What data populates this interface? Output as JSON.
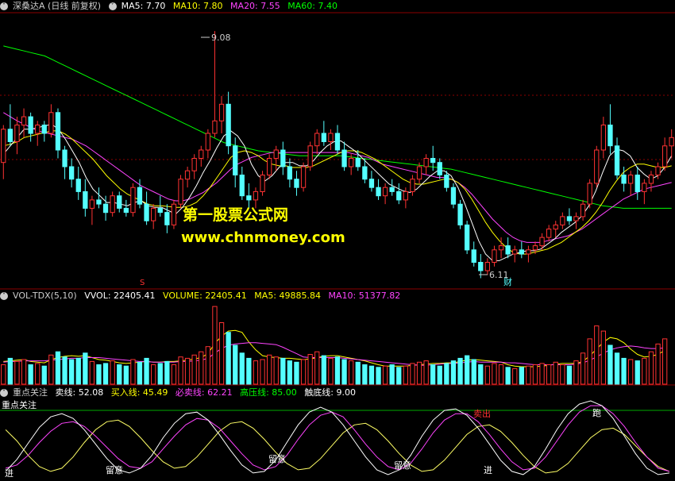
{
  "price_panel": {
    "title": "深桑达A (日线 前复权)",
    "ma5_label": "MA5: 7.70",
    "ma10_label": "MA10: 7.80",
    "ma20_label": "MA20: 7.55",
    "ma60_label": "MA60: 7.40",
    "high_annotation": "9.08",
    "low_annotation": "6.11",
    "marker_s": "S",
    "marker_cai": "财"
  },
  "volume_panel": {
    "title": "VOL-TDX(5,10)",
    "vvol_label": "VVOL: 22405.41",
    "volume_label": "VOLUME: 22405.41",
    "ma5_label": "MA5: 49885.84",
    "ma10_label": "MA10: 51377.82"
  },
  "indicator_panel": {
    "title": "重点关注",
    "sell_label": "卖线: 52.08",
    "buy_label": "买入线: 45.49",
    "must_sell_label": "必卖线: 62.21",
    "pressure_label": "高压线: 85.00",
    "bottom_label": "触底线: 9.00",
    "inner_title": "重点关注",
    "signals": [
      "进",
      "留意",
      "留意",
      "留意",
      "进",
      "卖出",
      "跑"
    ]
  },
  "watermark": {
    "line1": "第一股票公式网",
    "line2": "www.chnmoney.com"
  },
  "colors": {
    "up": "#ff3232",
    "down": "#54ffff",
    "ma5": "#ffffff",
    "ma10": "#ffff00",
    "ma20": "#ff44ff",
    "ma60": "#00ff00",
    "grid": "#8b0000"
  },
  "chart_data": {
    "type": "candlestick",
    "price_ylim": [
      6.0,
      9.3
    ],
    "candles": [
      [
        7.5,
        7.95,
        7.3,
        7.9
      ],
      [
        7.9,
        8.2,
        7.7,
        7.75
      ],
      [
        7.75,
        8.05,
        7.6,
        7.95
      ],
      [
        7.95,
        8.15,
        7.8,
        8.05
      ],
      [
        8.05,
        8.1,
        7.75,
        7.85
      ],
      [
        7.85,
        8.0,
        7.7,
        7.95
      ],
      [
        7.95,
        8.0,
        7.75,
        7.85
      ],
      [
        7.85,
        8.2,
        7.8,
        8.1
      ],
      [
        8.1,
        8.15,
        7.55,
        7.65
      ],
      [
        7.65,
        7.7,
        7.3,
        7.45
      ],
      [
        7.45,
        7.55,
        7.2,
        7.3
      ],
      [
        7.3,
        7.45,
        7.05,
        7.15
      ],
      [
        7.15,
        7.3,
        6.85,
        6.95
      ],
      [
        6.95,
        7.1,
        6.75,
        7.05
      ],
      [
        7.05,
        7.2,
        6.95,
        7.0
      ],
      [
        7.0,
        7.1,
        6.8,
        6.9
      ],
      [
        6.9,
        7.15,
        6.85,
        7.1
      ],
      [
        7.1,
        7.15,
        6.9,
        6.95
      ],
      [
        6.95,
        7.05,
        6.85,
        6.9
      ],
      [
        6.9,
        7.25,
        6.85,
        7.2
      ],
      [
        7.2,
        7.3,
        6.95,
        7.0
      ],
      [
        7.0,
        7.15,
        6.75,
        6.8
      ],
      [
        6.8,
        7.0,
        6.7,
        6.95
      ],
      [
        6.95,
        7.1,
        6.85,
        6.9
      ],
      [
        6.9,
        7.0,
        6.65,
        6.75
      ],
      [
        6.75,
        7.05,
        6.7,
        7.0
      ],
      [
        7.0,
        7.35,
        6.95,
        7.3
      ],
      [
        7.3,
        7.45,
        7.2,
        7.4
      ],
      [
        7.4,
        7.6,
        7.3,
        7.55
      ],
      [
        7.55,
        7.7,
        7.45,
        7.65
      ],
      [
        7.65,
        7.9,
        7.55,
        7.85
      ],
      [
        7.85,
        9.08,
        7.8,
        8.0
      ],
      [
        8.0,
        8.3,
        7.85,
        8.2
      ],
      [
        8.2,
        8.35,
        7.6,
        7.7
      ],
      [
        7.7,
        7.8,
        7.2,
        7.35
      ],
      [
        7.35,
        7.45,
        7.05,
        7.1
      ],
      [
        7.1,
        7.25,
        6.95,
        7.05
      ],
      [
        7.05,
        7.2,
        6.95,
        7.15
      ],
      [
        7.15,
        7.4,
        7.1,
        7.35
      ],
      [
        7.35,
        7.6,
        7.3,
        7.55
      ],
      [
        7.55,
        7.7,
        7.4,
        7.65
      ],
      [
        7.65,
        7.75,
        7.35,
        7.45
      ],
      [
        7.45,
        7.55,
        7.2,
        7.3
      ],
      [
        7.3,
        7.4,
        7.1,
        7.2
      ],
      [
        7.2,
        7.5,
        7.15,
        7.45
      ],
      [
        7.45,
        7.75,
        7.4,
        7.7
      ],
      [
        7.7,
        7.9,
        7.6,
        7.85
      ],
      [
        7.85,
        8.0,
        7.7,
        7.75
      ],
      [
        7.75,
        7.9,
        7.65,
        7.85
      ],
      [
        7.85,
        7.95,
        7.6,
        7.65
      ],
      [
        7.65,
        7.75,
        7.4,
        7.45
      ],
      [
        7.45,
        7.6,
        7.35,
        7.55
      ],
      [
        7.55,
        7.65,
        7.4,
        7.45
      ],
      [
        7.45,
        7.55,
        7.25,
        7.3
      ],
      [
        7.3,
        7.4,
        7.15,
        7.2
      ],
      [
        7.2,
        7.3,
        7.05,
        7.1
      ],
      [
        7.1,
        7.25,
        7.0,
        7.2
      ],
      [
        7.2,
        7.3,
        7.1,
        7.15
      ],
      [
        7.15,
        7.25,
        7.0,
        7.05
      ],
      [
        7.05,
        7.2,
        6.95,
        7.15
      ],
      [
        7.15,
        7.35,
        7.1,
        7.3
      ],
      [
        7.3,
        7.5,
        7.25,
        7.45
      ],
      [
        7.45,
        7.6,
        7.35,
        7.55
      ],
      [
        7.55,
        7.7,
        7.4,
        7.5
      ],
      [
        7.5,
        7.55,
        7.3,
        7.35
      ],
      [
        7.35,
        7.4,
        7.15,
        7.2
      ],
      [
        7.2,
        7.25,
        6.95,
        7.0
      ],
      [
        7.0,
        7.05,
        6.7,
        6.75
      ],
      [
        6.75,
        6.8,
        6.4,
        6.45
      ],
      [
        6.45,
        6.55,
        6.25,
        6.3
      ],
      [
        6.3,
        6.4,
        6.11,
        6.2
      ],
      [
        6.2,
        6.35,
        6.15,
        6.3
      ],
      [
        6.3,
        6.5,
        6.25,
        6.45
      ],
      [
        6.45,
        6.6,
        6.35,
        6.5
      ],
      [
        6.5,
        6.6,
        6.35,
        6.4
      ],
      [
        6.4,
        6.5,
        6.3,
        6.45
      ],
      [
        6.45,
        6.55,
        6.35,
        6.4
      ],
      [
        6.4,
        6.5,
        6.3,
        6.45
      ],
      [
        6.45,
        6.55,
        6.4,
        6.5
      ],
      [
        6.5,
        6.65,
        6.45,
        6.6
      ],
      [
        6.6,
        6.75,
        6.55,
        6.7
      ],
      [
        6.7,
        6.8,
        6.6,
        6.75
      ],
      [
        6.75,
        6.9,
        6.7,
        6.85
      ],
      [
        6.85,
        6.95,
        6.75,
        6.8
      ],
      [
        6.8,
        6.9,
        6.7,
        6.85
      ],
      [
        6.85,
        7.05,
        6.8,
        7.0
      ],
      [
        7.0,
        7.3,
        6.95,
        7.25
      ],
      [
        7.25,
        7.7,
        7.2,
        7.65
      ],
      [
        7.65,
        8.05,
        7.55,
        7.95
      ],
      [
        7.95,
        8.2,
        7.6,
        7.7
      ],
      [
        7.7,
        7.8,
        7.3,
        7.35
      ],
      [
        7.35,
        7.45,
        7.15,
        7.25
      ],
      [
        7.25,
        7.4,
        7.1,
        7.35
      ],
      [
        7.35,
        7.45,
        7.05,
        7.15
      ],
      [
        7.15,
        7.3,
        7.0,
        7.25
      ],
      [
        7.25,
        7.4,
        7.15,
        7.35
      ],
      [
        7.35,
        7.5,
        7.3,
        7.45
      ],
      [
        7.45,
        7.8,
        7.4,
        7.7
      ],
      [
        7.7,
        7.9,
        7.55,
        7.8
      ]
    ],
    "ma5": [
      7.6,
      7.7,
      7.8,
      7.9,
      7.9,
      7.92,
      7.94,
      7.96,
      7.9,
      7.78,
      7.64,
      7.5,
      7.32,
      7.18,
      7.1,
      7.02,
      7.02,
      7.0,
      6.98,
      7.02,
      7.04,
      6.98,
      6.96,
      6.96,
      6.92,
      6.88,
      6.96,
      7.08,
      7.22,
      7.38,
      7.52,
      7.68,
      7.82,
      7.88,
      7.82,
      7.7,
      7.48,
      7.34,
      7.28,
      7.34,
      7.44,
      7.5,
      7.5,
      7.46,
      7.46,
      7.52,
      7.62,
      7.7,
      7.75,
      7.76,
      7.7,
      7.64,
      7.56,
      7.48,
      7.4,
      7.32,
      7.24,
      7.2,
      7.16,
      7.14,
      7.18,
      7.26,
      7.34,
      7.4,
      7.4,
      7.34,
      7.2,
      7.0,
      6.78,
      6.56,
      6.4,
      6.32,
      6.32,
      6.36,
      6.4,
      6.42,
      6.44,
      6.44,
      6.46,
      6.52,
      6.58,
      6.66,
      6.72,
      6.78,
      6.86,
      6.98,
      7.16,
      7.38,
      7.58,
      7.66,
      7.64,
      7.58,
      7.44,
      7.36,
      7.3,
      7.34,
      7.44,
      7.58
    ],
    "ma10": [
      7.7,
      7.72,
      7.75,
      7.8,
      7.82,
      7.84,
      7.86,
      7.88,
      7.88,
      7.84,
      7.78,
      7.7,
      7.62,
      7.54,
      7.44,
      7.34,
      7.26,
      7.18,
      7.12,
      7.08,
      7.04,
      7.0,
      6.98,
      6.98,
      6.97,
      6.96,
      6.96,
      6.98,
      7.02,
      7.1,
      7.2,
      7.32,
      7.44,
      7.56,
      7.62,
      7.64,
      7.62,
      7.58,
      7.52,
      7.48,
      7.46,
      7.46,
      7.44,
      7.44,
      7.44,
      7.46,
      7.5,
      7.54,
      7.58,
      7.62,
      7.64,
      7.64,
      7.62,
      7.58,
      7.54,
      7.48,
      7.42,
      7.36,
      7.3,
      7.26,
      7.24,
      7.24,
      7.26,
      7.28,
      7.3,
      7.3,
      7.26,
      7.18,
      7.06,
      6.92,
      6.78,
      6.66,
      6.56,
      6.48,
      6.42,
      6.4,
      6.4,
      6.42,
      6.44,
      6.46,
      6.5,
      6.54,
      6.6,
      6.66,
      6.72,
      6.8,
      6.9,
      7.02,
      7.16,
      7.28,
      7.38,
      7.44,
      7.48,
      7.48,
      7.46,
      7.44,
      7.44,
      7.46
    ],
    "ma20": [
      8.1,
      8.05,
      8.0,
      7.96,
      7.92,
      7.88,
      7.86,
      7.84,
      7.82,
      7.8,
      7.78,
      7.74,
      7.7,
      7.64,
      7.58,
      7.52,
      7.46,
      7.4,
      7.34,
      7.28,
      7.22,
      7.18,
      7.14,
      7.1,
      7.06,
      7.04,
      7.04,
      7.06,
      7.1,
      7.14,
      7.2,
      7.26,
      7.34,
      7.42,
      7.48,
      7.52,
      7.56,
      7.58,
      7.6,
      7.62,
      7.62,
      7.62,
      7.62,
      7.62,
      7.62,
      7.62,
      7.62,
      7.62,
      7.62,
      7.62,
      7.62,
      7.6,
      7.58,
      7.56,
      7.52,
      7.48,
      7.46,
      7.44,
      7.42,
      7.4,
      7.38,
      7.36,
      7.34,
      7.32,
      7.32,
      7.3,
      7.26,
      7.2,
      7.12,
      7.02,
      6.92,
      6.82,
      6.74,
      6.66,
      6.6,
      6.56,
      6.54,
      6.54,
      6.54,
      6.56,
      6.58,
      6.6,
      6.62,
      6.66,
      6.7,
      6.76,
      6.82,
      6.88,
      6.94,
      7.0,
      7.06,
      7.1,
      7.14,
      7.18,
      7.2,
      7.22,
      7.24,
      7.26
    ],
    "ma60": [
      8.9,
      8.88,
      8.86,
      8.84,
      8.82,
      8.8,
      8.78,
      8.74,
      8.7,
      8.66,
      8.62,
      8.58,
      8.54,
      8.5,
      8.46,
      8.42,
      8.38,
      8.34,
      8.3,
      8.26,
      8.22,
      8.18,
      8.14,
      8.1,
      8.06,
      8.02,
      7.98,
      7.94,
      7.9,
      7.86,
      7.82,
      7.78,
      7.74,
      7.72,
      7.7,
      7.68,
      7.66,
      7.64,
      7.63,
      7.62,
      7.61,
      7.6,
      7.59,
      7.58,
      7.58,
      7.58,
      7.58,
      7.58,
      7.58,
      7.58,
      7.57,
      7.56,
      7.55,
      7.54,
      7.53,
      7.52,
      7.51,
      7.5,
      7.49,
      7.48,
      7.47,
      7.46,
      7.45,
      7.44,
      7.43,
      7.42,
      7.4,
      7.38,
      7.36,
      7.34,
      7.32,
      7.3,
      7.28,
      7.26,
      7.24,
      7.22,
      7.2,
      7.18,
      7.16,
      7.14,
      7.12,
      7.1,
      7.08,
      7.06,
      7.04,
      7.02,
      7.0,
      6.98,
      6.97,
      6.96,
      6.95,
      6.95,
      6.95,
      6.95,
      6.95,
      6.95,
      6.95,
      6.95
    ],
    "volume": [
      30,
      40,
      35,
      38,
      30,
      32,
      28,
      45,
      50,
      42,
      38,
      40,
      48,
      35,
      30,
      32,
      36,
      30,
      28,
      38,
      34,
      40,
      30,
      32,
      35,
      30,
      42,
      40,
      45,
      50,
      58,
      120,
      95,
      80,
      60,
      48,
      40,
      36,
      38,
      45,
      42,
      40,
      36,
      34,
      38,
      46,
      50,
      44,
      40,
      42,
      38,
      36,
      34,
      30,
      28,
      26,
      28,
      30,
      26,
      28,
      32,
      34,
      36,
      30,
      28,
      32,
      36,
      40,
      44,
      38,
      30,
      28,
      32,
      30,
      26,
      24,
      26,
      28,
      30,
      32,
      30,
      34,
      30,
      28,
      36,
      48,
      70,
      90,
      82,
      60,
      48,
      40,
      38,
      36,
      40,
      50,
      62,
      70
    ],
    "vol_ylim": [
      0,
      125
    ],
    "vol_ma5": [
      35,
      36,
      37,
      38,
      35,
      34,
      33,
      38,
      41,
      43,
      44,
      43,
      44,
      41,
      38,
      37,
      35,
      33,
      32,
      33,
      34,
      35,
      34,
      34,
      35,
      35,
      36,
      37,
      39,
      41,
      47,
      63,
      74,
      82,
      83,
      80,
      65,
      53,
      44,
      42,
      41,
      40,
      40,
      39,
      38,
      39,
      41,
      43,
      44,
      44,
      42,
      40,
      38,
      36,
      33,
      30,
      28,
      28,
      28,
      28,
      29,
      30,
      31,
      32,
      32,
      33,
      33,
      35,
      37,
      38,
      37,
      36,
      35,
      34,
      30,
      28,
      27,
      27,
      27,
      28,
      29,
      31,
      32,
      32,
      32,
      35,
      44,
      54,
      65,
      72,
      70,
      64,
      54,
      46,
      42,
      43,
      46,
      52
    ],
    "vol_ma10": [
      34,
      35,
      35,
      36,
      36,
      36,
      36,
      37,
      38,
      39,
      40,
      40,
      41,
      41,
      41,
      40,
      39,
      38,
      37,
      36,
      35,
      35,
      34,
      34,
      34,
      34,
      35,
      35,
      36,
      37,
      40,
      48,
      55,
      60,
      62,
      63,
      64,
      64,
      63,
      62,
      61,
      57,
      52,
      47,
      42,
      41,
      41,
      41,
      41,
      41,
      40,
      39,
      38,
      37,
      36,
      35,
      34,
      33,
      32,
      31,
      30,
      29,
      29,
      30,
      31,
      32,
      32,
      33,
      34,
      35,
      34,
      34,
      34,
      34,
      33,
      33,
      32,
      31,
      30,
      30,
      30,
      30,
      30,
      30,
      31,
      33,
      37,
      42,
      48,
      53,
      56,
      58,
      59,
      58,
      56,
      55,
      55,
      56
    ],
    "osc_ylim": [
      0,
      100
    ],
    "osc_white": [
      10,
      25,
      45,
      65,
      78,
      82,
      76,
      62,
      44,
      26,
      12,
      8,
      14,
      30,
      52,
      70,
      82,
      84,
      74,
      56,
      36,
      18,
      8,
      10,
      24,
      46,
      68,
      84,
      90,
      84,
      68,
      48,
      28,
      12,
      6,
      12,
      30,
      54,
      74,
      86,
      88,
      80,
      64,
      44,
      24,
      10,
      6,
      16,
      38,
      62,
      82,
      94,
      98,
      92,
      76,
      54,
      32,
      14,
      6,
      8
    ],
    "osc_magenta": [
      14,
      18,
      30,
      46,
      60,
      70,
      72,
      66,
      54,
      40,
      26,
      16,
      14,
      22,
      38,
      54,
      68,
      76,
      74,
      64,
      48,
      32,
      18,
      12,
      16,
      30,
      50,
      68,
      80,
      84,
      78,
      62,
      44,
      28,
      16,
      12,
      20,
      38,
      58,
      74,
      82,
      82,
      72,
      56,
      38,
      22,
      12,
      14,
      28,
      48,
      68,
      84,
      92,
      92,
      82,
      66,
      46,
      28,
      14,
      10
    ],
    "osc_yellow": [
      62,
      48,
      30,
      16,
      10,
      14,
      28,
      46,
      62,
      72,
      74,
      66,
      52,
      36,
      22,
      14,
      16,
      28,
      44,
      60,
      70,
      72,
      64,
      50,
      34,
      20,
      12,
      14,
      26,
      42,
      58,
      68,
      70,
      62,
      48,
      32,
      18,
      10,
      12,
      24,
      40,
      56,
      66,
      68,
      60,
      46,
      30,
      16,
      8,
      10,
      20,
      36,
      52,
      62,
      64,
      56,
      42,
      28,
      16,
      10
    ]
  }
}
